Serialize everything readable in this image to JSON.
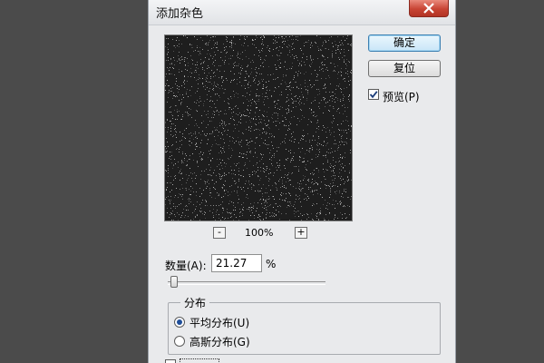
{
  "window": {
    "title": "添加杂色"
  },
  "preview": {
    "zoom_level": "100%",
    "zoom_out": "-",
    "zoom_in": "+"
  },
  "buttons": {
    "ok": "确定",
    "reset": "复位"
  },
  "preview_toggle": {
    "label": "预览(P)",
    "checked": true
  },
  "amount": {
    "label": "数量(A):",
    "value": "21.27",
    "unit": "%",
    "slider_value_percent": 21.27
  },
  "distribution": {
    "legend": "分布",
    "options": [
      {
        "label": "平均分布(U)",
        "selected": true
      },
      {
        "label": "高斯分布(G)",
        "selected": false
      }
    ]
  },
  "colors": {
    "desktop": "#4b4b4b",
    "dialog_bg": "#e9eaec",
    "close_button": "#c84434",
    "radio_selected": "#1f4e99"
  }
}
